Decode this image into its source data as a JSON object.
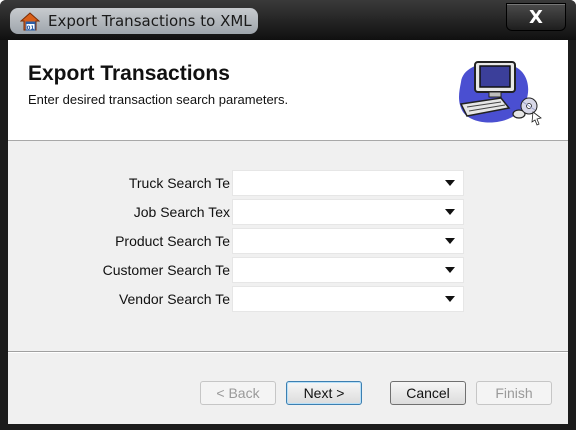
{
  "window": {
    "title": "Export Transactions to XML",
    "close_label": "X"
  },
  "header": {
    "title": "Export Transactions",
    "subtitle": "Enter desired transaction search parameters."
  },
  "form": {
    "fields": [
      {
        "label": "Truck Search Te",
        "value": ""
      },
      {
        "label": "Job Search Tex",
        "value": ""
      },
      {
        "label": "Product Search Te",
        "value": ""
      },
      {
        "label": "Customer Search Te",
        "value": ""
      },
      {
        "label": "Vendor Search Te",
        "value": ""
      }
    ]
  },
  "buttons": {
    "back": "< Back",
    "next": "Next >",
    "cancel": "Cancel",
    "finish": "Finish"
  },
  "icons": {
    "app": "home-calendar-icon",
    "header_art": "computer-clipart-icon",
    "dropdown": "chevron-down-icon"
  }
}
